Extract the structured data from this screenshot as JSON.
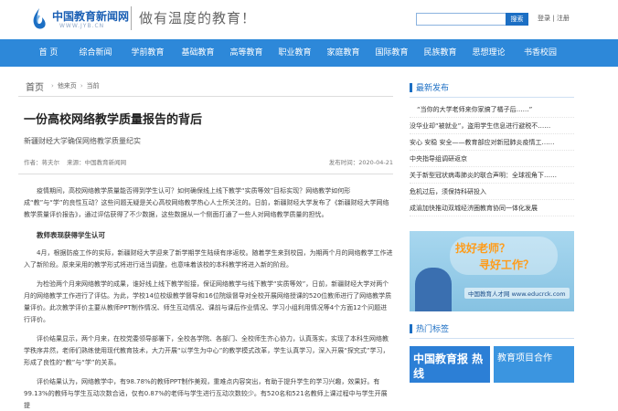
{
  "header": {
    "logo_text": "中国教育新闻网",
    "logo_sub": "WWW.JYB.CN",
    "slogan": "做有温度的教育！",
    "search_placeholder": "",
    "search_button": "搜索",
    "login": "登录",
    "register": "注册",
    "auth_sep": "|"
  },
  "nav": [
    "首 页",
    "综合新闻",
    "学前教育",
    "基础教育",
    "高等教育",
    "职业教育",
    "家庭教育",
    "国际教育",
    "民族教育",
    "思想理论",
    "书香校园"
  ],
  "breadcrumb": {
    "home": "首页",
    "items": [
      "他来页",
      "当前"
    ]
  },
  "article": {
    "title": "一份高校网络教学质量报告的背后",
    "subtitle": "新疆财经大学确保网络教学质量纪实",
    "author": "作者：蒋夫尔",
    "source": "来源：中国教育新闻网",
    "date": "发布时间：2020-04-21",
    "p1": "疫情期间，高校网络教学质量能否得到学生认可？如何确保线上线下教学“实质等效”目标实现？网络教学如何形成“教”与“学”的良性互动？这些问题无疑是关心高校网络教学热心人士所关注的。日前，新疆财经大学发布了《新疆财经大学网络教学质量评价报告》，通过评估获得了不少数据，这些数据从一个侧面打通了一些人对网络教学质量的担忧。",
    "h1": "教师表现获得学生认可",
    "p2": "4月，根据防疫工作的实际，新疆财经大学迎来了新学期学生陆续有序返校。随着学生来到校园，为期两个月的网络教学工作进入了新阶段。原来采用的教学形式将进行适当调整，也意味着该校的本科教学将进入新的阶段。",
    "p3": "为检验两个月来网络教学的成果，谁好线上线下教学衔接，保证网络教学与线下教学“实质等效”，日前，新疆财经大学对两个月的网络教学工作进行了评估。为此，学校14位校级教学督导和16位院级督导对全校开展网络授课的520位教师进行了网络教学质量评价。此次教学评价主要从教师PPT制作情况、师生互动情况、课前与课后作业情况、学习小组利用情况等4个方面12个问题进行评价。",
    "p4": "评价结果显示，两个月来，在校党委领导部署下，全校各学院、各部门、全校师生齐心协力，认真落实，实现了本科生网络教学秩序井然，老师们熟练使用现代教育技术，大力开展“以学生为中心”的教学模式改革，学生认真学习，深入开展“探究式”学习，形成了良性的“教”与“学”的关系。",
    "p5": "评价结果认为，网络教学中，有98.78%的教师PPT制作美观，重难点内容突出，有助于提升学生的学习兴趣，效果好。有99.13%的教师与学生互动次数合适，仅有0.87%的老师与学生进行互动次数较少。有520名和521名教师上课过程中与学生开展提"
  },
  "sidebar": {
    "latest_title": "最新发布",
    "latest": [
      "“当你的大学老师来你家搞了橘子后……”",
      "没华业却“被就业”，盗用学生信息进行避税不……",
      "安心 安稳 安全——教育部应对新冠肺炎疫情工……",
      "中央指导组调研返京",
      "关于新型冠状病毒肺炎的联合声明：全球视角下……",
      "危机过后，须保持科研投入",
      "成渝加快推动双城经济圈教育协同一体化发展"
    ],
    "banner": {
      "main": "找好老师？",
      "sub": "寻好工作？",
      "logo": "中国教育人才网 www.educrck.com"
    },
    "tags_title": "热门标签",
    "tags": [
      "中国教育报 热线",
      "教育项目合作"
    ]
  },
  "colors": {
    "nav_bg": "#2d88d9",
    "accent": "#1c6fc4"
  }
}
